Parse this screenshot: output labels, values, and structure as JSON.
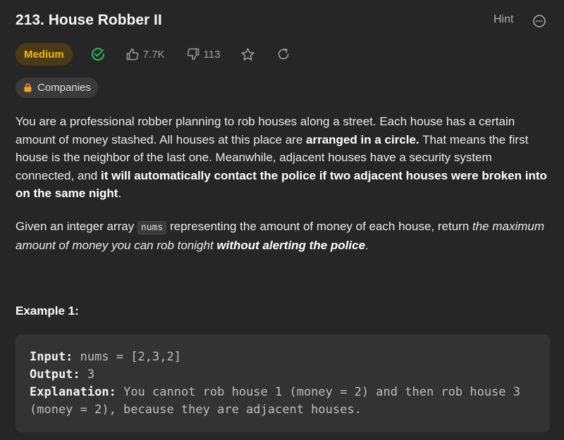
{
  "problem": {
    "title": "213. House Robber II",
    "hint_label": "Hint",
    "difficulty": "Medium",
    "likes": "7.7K",
    "dislikes": "113",
    "companies_label": "Companies"
  },
  "description": {
    "p1": [
      {
        "text": "You are a professional robber planning to rob houses along a street. Each house has a certain amount of money stashed. All houses at this place are "
      },
      {
        "text": "arranged in a circle.",
        "bold": true
      },
      {
        "text": " That means the first house is the neighbor of the last one. Meanwhile, adjacent houses have a security system connected, and "
      },
      {
        "text": "it will automatically contact the police if two adjacent houses were broken into on the same night",
        "bold": true
      },
      {
        "text": "."
      }
    ],
    "p2": [
      {
        "text": "Given an integer array "
      },
      {
        "text": "nums",
        "code": true
      },
      {
        "text": " representing the amount of money of each house, return "
      },
      {
        "text": "the maximum amount of money you can rob tonight ",
        "italic": true
      },
      {
        "text": "without alerting the police",
        "bold": true,
        "italic": true
      },
      {
        "text": "."
      }
    ]
  },
  "example": {
    "title": "Example 1:",
    "input_label": "Input:",
    "input_value": "nums = [2,3,2]",
    "output_label": "Output:",
    "output_value": "3",
    "explanation_label": "Explanation:",
    "explanation_value": "You cannot rob house 1 (money = 2) and then rob house 3 (money = 2), because they are adjacent houses."
  },
  "colors": {
    "background": "#262626",
    "difficulty_medium": "#ffb800",
    "solved_check": "#2cbb5d"
  },
  "icons": [
    "check-circle-icon",
    "thumbs-up-icon",
    "thumbs-down-icon",
    "star-icon",
    "share-icon",
    "lock-icon",
    "more-icon"
  ]
}
